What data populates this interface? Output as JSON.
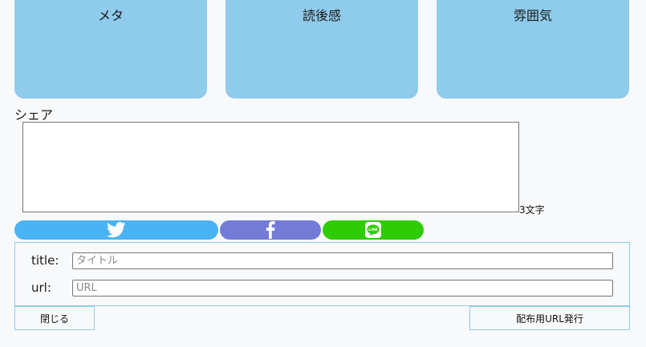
{
  "cards": [
    {
      "label": "メタ"
    },
    {
      "label": "読後感"
    },
    {
      "label": "雰囲気"
    }
  ],
  "share": {
    "label": "シェア",
    "text_value": "",
    "char_count": "3文字"
  },
  "sns_buttons": [
    {
      "name": "twitter",
      "icon": "twitter-bird-icon",
      "color": "#4ab3f4"
    },
    {
      "name": "facebook",
      "icon": "facebook-f-icon",
      "color": "#727bd6"
    },
    {
      "name": "line",
      "icon": "line-logo-icon",
      "color": "#2fcc05",
      "logo_text": "LINE"
    }
  ],
  "url_form": {
    "title_label": "title:",
    "title_placeholder": "タイトル",
    "title_value": "",
    "url_label": "url:",
    "url_placeholder": "URL",
    "url_value": ""
  },
  "actions": {
    "close_label": "閉じる",
    "issue_label": "配布用URL発行"
  },
  "colors": {
    "card_bg": "#8fcbea",
    "panel_border": "#8fcbea",
    "page_bg": "#f8f9fb"
  }
}
